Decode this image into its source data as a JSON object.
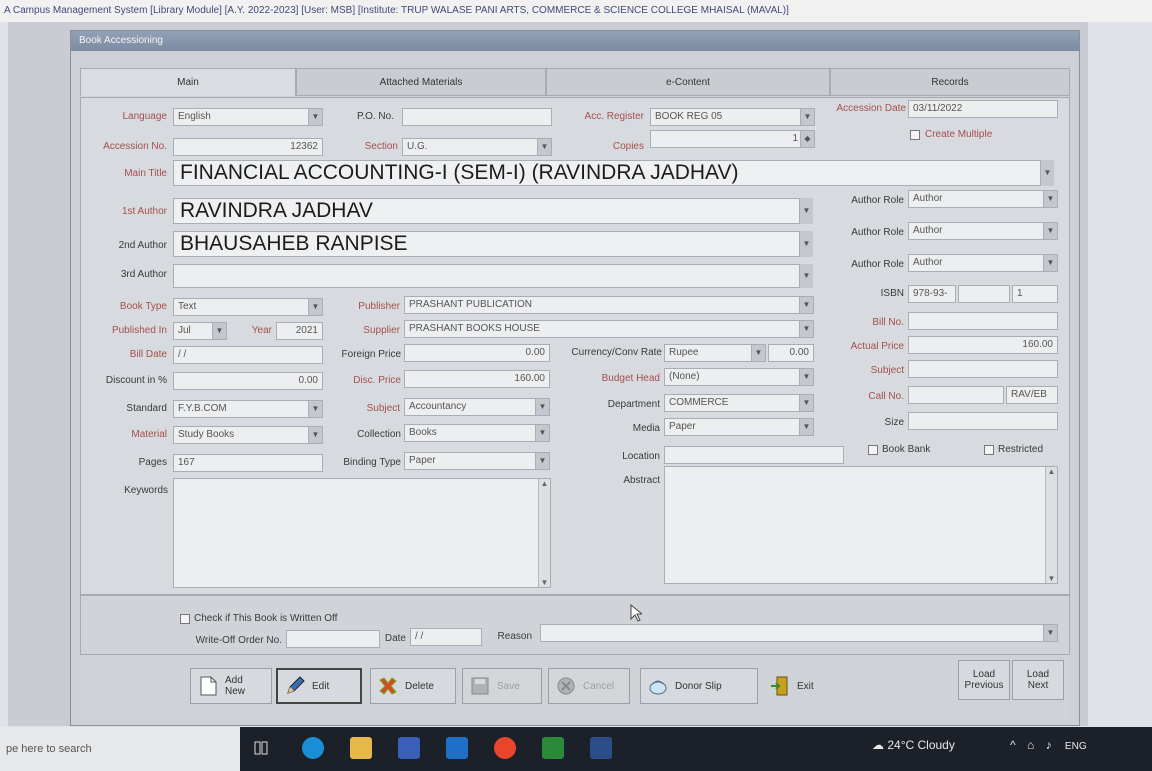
{
  "app_title": "A Campus Management System [Library Module] [A.Y. 2022-2023] [User: MSB] [Institute: TRUP WALASE PANI ARTS, COMMERCE & SCIENCE COLLEGE MHAISAL (MAVAL)]",
  "dialog_title": "Book Accessioning",
  "tabs": [
    "Main",
    "Attached Materials",
    "e-Content",
    "Records"
  ],
  "form": {
    "language": {
      "label": "Language",
      "value": "English"
    },
    "po_no": {
      "label": "P.O. No.",
      "value": ""
    },
    "acc_register": {
      "label": "Acc. Register",
      "value": "BOOK REG 05"
    },
    "accession_date": {
      "label": "Accession Date",
      "value": "03/11/2022"
    },
    "accession_no": {
      "label": "Accession No.",
      "value": "12362"
    },
    "section": {
      "label": "Section",
      "value": "U.G."
    },
    "copies": {
      "label": "Copies",
      "value": ""
    },
    "copies_spin": "1",
    "create_multiple": {
      "label": "Create Multiple"
    },
    "main_title": {
      "label": "Main Title",
      "value": "FINANCIAL ACCOUNTING-I (SEM-I) (RAVINDRA JADHAV)"
    },
    "author1": {
      "label": "1st Author",
      "value": "RAVINDRA JADHAV"
    },
    "author2": {
      "label": "2nd Author",
      "value": "BHAUSAHEB RANPISE"
    },
    "author3": {
      "label": "3rd Author",
      "value": ""
    },
    "author_role_label": "Author Role",
    "author_roles": [
      "Author",
      "Author",
      "Author"
    ],
    "isbn": {
      "label": "ISBN",
      "value": "978-93-",
      "value2": "",
      "value3": "1"
    },
    "book_type": {
      "label": "Book Type",
      "value": "Text"
    },
    "publisher": {
      "label": "Publisher",
      "value": "PRASHANT PUBLICATION"
    },
    "published_in": {
      "label": "Published In",
      "month": "Jul",
      "year_label": "Year",
      "year": "2021"
    },
    "supplier": {
      "label": "Supplier",
      "value": "PRASHANT BOOKS HOUSE"
    },
    "bill_no": {
      "label": "Bill No.",
      "value": ""
    },
    "bill_date": {
      "label": "Bill Date",
      "value": "/ /"
    },
    "foreign_price": {
      "label": "Foreign Price",
      "value": "0.00"
    },
    "currency": {
      "label": "Currency/Conv Rate",
      "value": "Rupee",
      "rate": "0.00"
    },
    "actual_price": {
      "label": "Actual Price",
      "value": "160.00"
    },
    "discount": {
      "label": "Discount in %",
      "value": "0.00"
    },
    "disc_price": {
      "label": "Disc. Price",
      "value": "160.00"
    },
    "budget_head": {
      "label": "Budget Head",
      "value": "(None)"
    },
    "subject_code": {
      "label": "Subject",
      "value": ""
    },
    "standard": {
      "label": "Standard",
      "value": "F.Y.B.COM"
    },
    "subject": {
      "label": "Subject",
      "value": "Accountancy"
    },
    "department": {
      "label": "Department",
      "value": "COMMERCE"
    },
    "call_no": {
      "label": "Call No.",
      "value": "",
      "value2": "RAV/EB"
    },
    "material": {
      "label": "Material",
      "value": "Study Books"
    },
    "collection": {
      "label": "Collection",
      "value": "Books"
    },
    "media": {
      "label": "Media",
      "value": "Paper"
    },
    "size": {
      "label": "Size",
      "value": ""
    },
    "book_bank": {
      "label": "Book Bank"
    },
    "restricted": {
      "label": "Restricted"
    },
    "pages": {
      "label": "Pages",
      "value": "167"
    },
    "binding": {
      "label": "Binding Type",
      "value": "Paper"
    },
    "location": {
      "label": "Location",
      "value": ""
    },
    "keywords": {
      "label": "Keywords",
      "value": ""
    },
    "abstract": {
      "label": "Abstract",
      "value": ""
    }
  },
  "writeoff": {
    "check_label": "Check if This Book is Written Off",
    "order_label": "Write-Off Order No.",
    "order_value": "",
    "date_label": "Date",
    "date_value": "/ /",
    "reason_label": "Reason",
    "reason_value": ""
  },
  "buttons": {
    "add_new": "Add New",
    "edit": "Edit",
    "delete": "Delete",
    "save": "Save",
    "cancel": "Cancel",
    "donor_slip": "Donor Slip",
    "exit": "Exit",
    "load_previous_1": "Load",
    "load_previous_2": "Previous",
    "load_next_1": "Load",
    "load_next_2": "Next"
  },
  "taskbar": {
    "search_placeholder": "pe here to search",
    "weather": "24°C  Cloudy",
    "lang": "ENG"
  },
  "colors": {
    "label_red": "#a5504e",
    "taskbar": "#1c2028",
    "dialog_header": "#7d8ba2"
  }
}
